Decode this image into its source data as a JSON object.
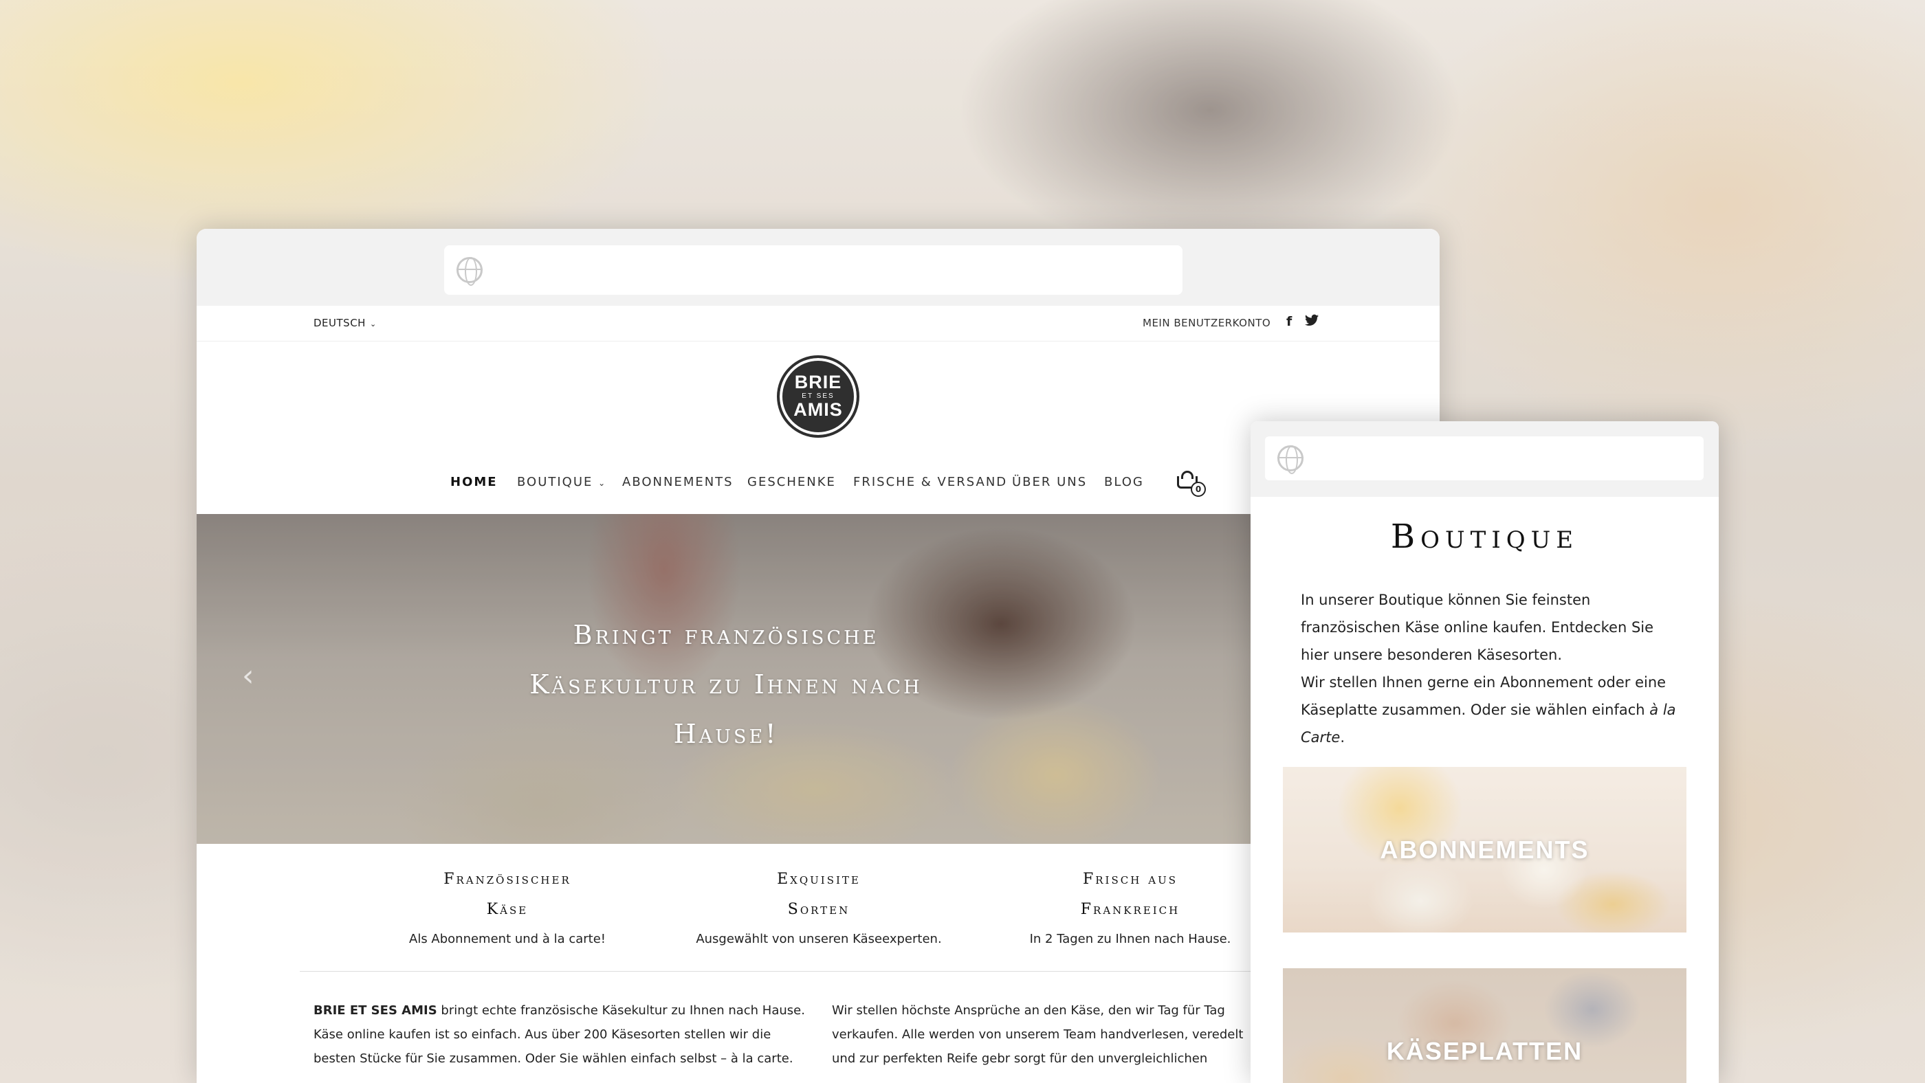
{
  "main_window": {
    "language": {
      "label": "DEUTSCH",
      "chevron": "chevron-down-icon"
    },
    "account_link": "MEIN BENUTZERKONTO",
    "social": {
      "facebook": "f",
      "twitter": "🐦"
    },
    "logo": {
      "line1": "BRIE",
      "line2": "ET SES",
      "line3": "AMIS"
    },
    "nav": [
      {
        "label": "HOME",
        "active": true
      },
      {
        "label": "BOUTIQUE",
        "has_dropdown": true
      },
      {
        "label": "ABONNEMENTS"
      },
      {
        "label": "GESCHENKE"
      },
      {
        "label": "FRISCHE & VERSAND"
      },
      {
        "label": "ÜBER UNS"
      },
      {
        "label": "BLOG"
      }
    ],
    "cart": {
      "count": "0",
      "icon": "cart-icon"
    },
    "hero": {
      "title": "Bringt französische Käsekultur zu Ihnen nach Hause!",
      "prev_arrow": "‹"
    },
    "features": [
      {
        "title_line1": "Französischer",
        "title_line2": "Käse",
        "description": "Als Abonnement und à la carte!"
      },
      {
        "title_line1": "Exquisite",
        "title_line2": "Sorten",
        "description": "Ausgewählt von unseren Käseexperten."
      },
      {
        "title_line1": "Frisch aus",
        "title_line2": "Frankreich",
        "description": "In 2 Tagen zu Ihnen nach Hause."
      }
    ],
    "about_left": {
      "brand": "BRIE ET SES AMIS",
      "text": " bringt echte französische Käsekultur zu Ihnen nach Hause. Käse online kaufen ist so einfach. Aus über 200 Käsesorten stellen wir die besten Stücke für Sie zusammen. Oder Sie wählen einfach selbst – à la carte."
    },
    "about_right": {
      "text": "Wir stellen höchste Ansprüche an den Käse, den wir Tag für Tag verkaufen. Alle werden von unserem Team handverlesen, veredelt und zur perfekten Reife gebr sorgt für den unvergleichlichen Geschmack von BRIE ET SES AMIS."
    }
  },
  "side_window": {
    "title": "Boutique",
    "text_part1": "In unserer Boutique können Sie feinsten französischen Käse online kaufen. Entdecken Sie hier unsere besonderen Käsesorten.",
    "text_part2": "Wir stellen Ihnen gerne ein Abonnement oder eine Käseplatte zusammen. Oder sie wählen einfach ",
    "text_italic": "à la Carte",
    "text_end": ".",
    "cards": [
      {
        "label": "ABONNEMENTS"
      },
      {
        "label": "KÄSEPLATTEN"
      }
    ]
  },
  "colors": {
    "chrome": "#f2f2f2",
    "logo_bg": "#2f2f2f",
    "text": "#222222"
  }
}
